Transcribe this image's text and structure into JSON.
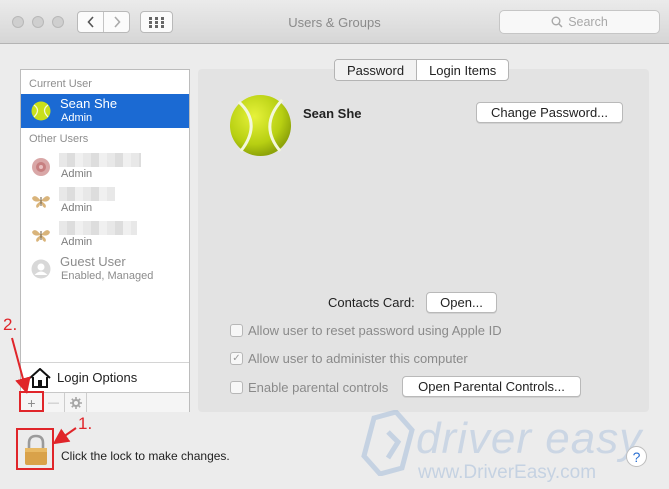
{
  "window": {
    "title": "Users & Groups",
    "search_placeholder": "Search"
  },
  "sidebar": {
    "current_user_label": "Current User",
    "other_users_label": "Other Users",
    "current_user": {
      "name": "Sean She",
      "role": "Admin"
    },
    "other_users": [
      {
        "role": "Admin"
      },
      {
        "role": "Admin"
      },
      {
        "role": "Admin"
      }
    ],
    "guest": {
      "name": "Guest User",
      "status": "Enabled, Managed"
    },
    "login_options": "Login Options",
    "toolbar": {
      "add": "+",
      "remove": "—"
    }
  },
  "tabs": [
    "Password",
    "Login Items"
  ],
  "main": {
    "display_name": "Sean She",
    "change_password": "Change Password...",
    "contacts_card_label": "Contacts Card:",
    "open_button": "Open...",
    "options": [
      {
        "label": "Allow user to reset password using Apple ID",
        "checked": false
      },
      {
        "label": "Allow user to administer this computer",
        "checked": true
      },
      {
        "label": "Enable parental controls",
        "checked": false
      }
    ],
    "parental_controls_button": "Open Parental Controls..."
  },
  "footer": {
    "lock_text": "Click the lock to make changes.",
    "help": "?"
  },
  "annotations": {
    "step1": "1.",
    "step2": "2."
  },
  "watermark": {
    "line1": "driver easy",
    "line2": "www.DriverEasy.com"
  },
  "colors": {
    "selection": "#1b6ad3",
    "annotation": "#e0252a",
    "tennis_ball": "#c9e01b"
  }
}
